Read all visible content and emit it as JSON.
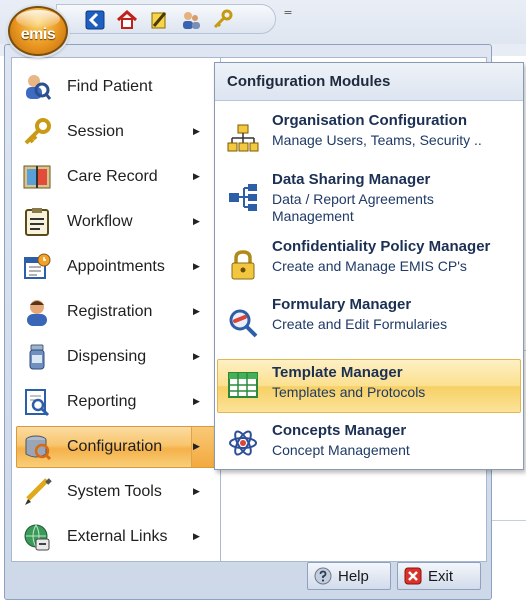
{
  "app": {
    "logo_text": "emis"
  },
  "quick_access": {
    "icons": [
      "back-icon",
      "home-icon",
      "edit-pencil-icon",
      "users-icon",
      "key-icon"
    ],
    "customize_glyph": "="
  },
  "main_menu": {
    "items": [
      {
        "label": "Find Patient",
        "icon": "find-patient-icon",
        "has_submenu": false,
        "active": false
      },
      {
        "label": "Session",
        "icon": "key-icon",
        "has_submenu": true,
        "active": false
      },
      {
        "label": "Care Record",
        "icon": "care-record-icon",
        "has_submenu": true,
        "active": false
      },
      {
        "label": "Workflow",
        "icon": "workflow-icon",
        "has_submenu": true,
        "active": false
      },
      {
        "label": "Appointments",
        "icon": "appointments-icon",
        "has_submenu": true,
        "active": false
      },
      {
        "label": "Registration",
        "icon": "registration-icon",
        "has_submenu": true,
        "active": false
      },
      {
        "label": "Dispensing",
        "icon": "dispensing-icon",
        "has_submenu": true,
        "active": false
      },
      {
        "label": "Reporting",
        "icon": "reporting-icon",
        "has_submenu": true,
        "active": false
      },
      {
        "label": "Configuration",
        "icon": "configuration-icon",
        "has_submenu": true,
        "active": true
      },
      {
        "label": "System Tools",
        "icon": "system-tools-icon",
        "has_submenu": true,
        "active": false
      },
      {
        "label": "External Links",
        "icon": "external-links-icon",
        "has_submenu": true,
        "active": false
      }
    ],
    "arrow_glyph": "▶"
  },
  "submenu": {
    "header": "Configuration Modules",
    "items": [
      {
        "title": "Organisation Configuration",
        "description": "Manage Users, Teams, Security ..",
        "icon": "org-chart-icon",
        "active": false
      },
      {
        "title": "Data Sharing Manager",
        "description": "Data / Report Agreements Management",
        "icon": "data-sharing-icon",
        "active": false
      },
      {
        "title": "Confidentiality Policy Manager",
        "description": "Create and Manage EMIS CP's",
        "icon": "padlock-icon",
        "active": false
      },
      {
        "title": "Formulary Manager",
        "description": "Create and Edit Formularies",
        "icon": "formulary-icon",
        "active": false
      },
      {
        "title": "Template Manager",
        "description": "Templates and Protocols",
        "icon": "template-grid-icon",
        "active": true
      },
      {
        "title": "Concepts Manager",
        "description": "Concept Management",
        "icon": "concepts-atom-icon",
        "active": false
      }
    ]
  },
  "footer": {
    "help_label": "Help",
    "exit_label": "Exit"
  },
  "colors": {
    "active_highlight": "#f8c56d",
    "frame": "#cdd8e8",
    "submenu_title": "#1c3054"
  }
}
